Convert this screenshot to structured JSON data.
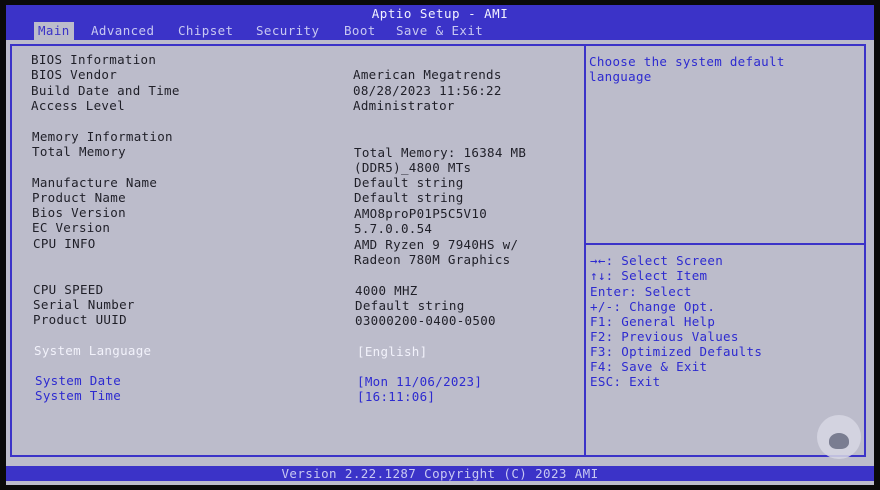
{
  "title": "Aptio Setup - AMI",
  "tabs": [
    {
      "label": "Main"
    },
    {
      "label": "Advanced"
    },
    {
      "label": "Chipset"
    },
    {
      "label": "Security"
    },
    {
      "label": "Boot"
    },
    {
      "label": "Save & Exit"
    }
  ],
  "bios_info": {
    "heading": "BIOS Information",
    "rows": [
      {
        "label": "BIOS Vendor",
        "value": "American Megatrends"
      },
      {
        "label": "Build Date and Time",
        "value": "08/28/2023 11:56:22"
      },
      {
        "label": "Access Level",
        "value": "Administrator"
      }
    ]
  },
  "memory_info": {
    "heading": "Memory Information",
    "total_memory_label": "Total Memory",
    "total_memory_value_line1": "Total Memory: 16384 MB",
    "total_memory_value_line2": "(DDR5)_4800 MTs"
  },
  "system_rows": [
    {
      "label": "Manufacture Name",
      "value": "Default string"
    },
    {
      "label": "Product Name",
      "value": "Default string"
    },
    {
      "label": "Bios Version",
      "value": "AMO8proP01P5C5V10"
    },
    {
      "label": "EC Version",
      "value": "5.7.0.0.54"
    }
  ],
  "cpu_info": {
    "label": "CPU INFO",
    "value_line1": "AMD Ryzen 9 7940HS w/",
    "value_line2": "Radeon 780M Graphics"
  },
  "cpu_rows": [
    {
      "label": "CPU SPEED",
      "value": "4000 MHZ"
    },
    {
      "label": "Serial Number",
      "value": "Default string"
    },
    {
      "label": "Product UUID",
      "value": "03000200-0400-0500"
    }
  ],
  "system_language": {
    "label": "System Language",
    "value": "[English]"
  },
  "system_date": {
    "label": "System Date",
    "value": "[Mon 11/06/2023]"
  },
  "system_time": {
    "label": "System Time",
    "value": "[16:11:06]"
  },
  "help_text_line1": "Choose the system default",
  "help_text_line2": "language",
  "key_help": [
    "→←: Select Screen",
    "↑↓: Select Item",
    "Enter: Select",
    "+/-: Change Opt.",
    "F1: General Help",
    "F2: Previous Values",
    "F3: Optimized Defaults",
    "F4: Save & Exit",
    "ESC: Exit"
  ],
  "footer": "Version 2.22.1287 Copyright (C) 2023 AMI",
  "colors": {
    "accent": "#3b33c8",
    "background": "#bcbccb",
    "link": "#2d2ad0"
  }
}
